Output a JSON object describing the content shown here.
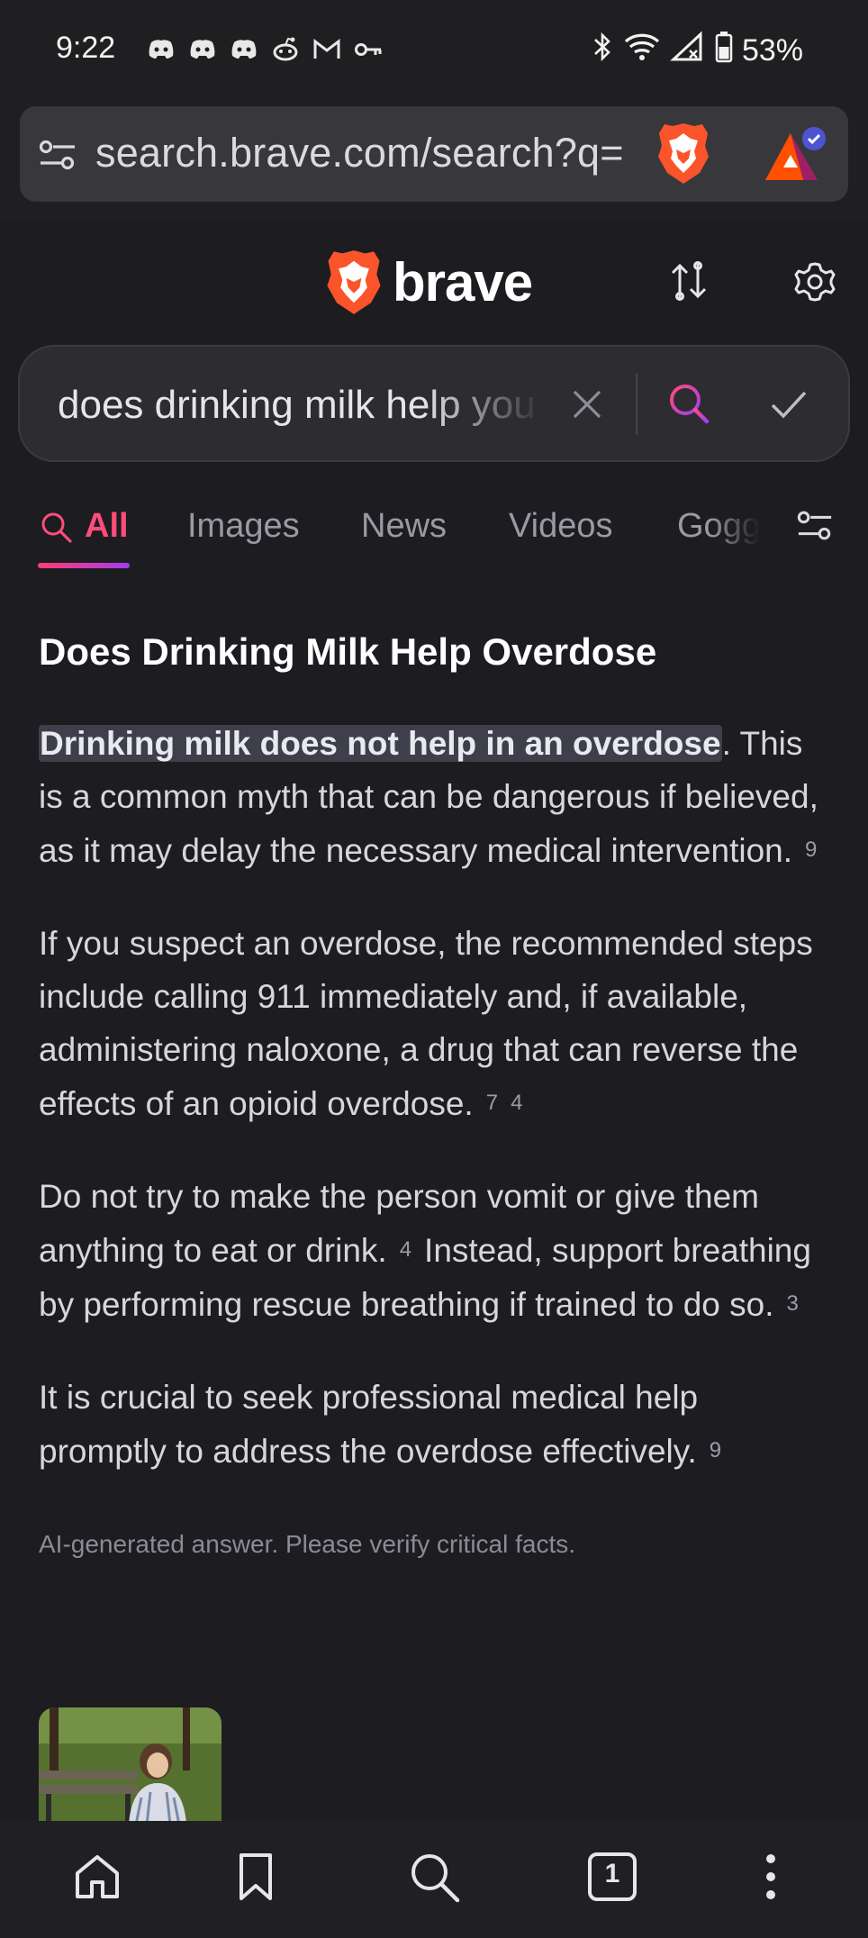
{
  "status_bar": {
    "time": "9:22",
    "battery": "53%"
  },
  "url_bar": {
    "url": "search.brave.com/search?q="
  },
  "header": {
    "brand": "brave"
  },
  "search": {
    "query": "does drinking milk help you overdose"
  },
  "tabs": [
    {
      "label": "All",
      "active": true
    },
    {
      "label": "Images"
    },
    {
      "label": "News"
    },
    {
      "label": "Videos"
    },
    {
      "label": "Goggles"
    }
  ],
  "answer": {
    "title": "Does Drinking Milk Help Overdose",
    "p1_highlight": "Drinking milk does not help in an overdose",
    "p1_line1_rest": ". This",
    "p1_rest": "is a common myth that can be dangerous if believed, as it may delay the necessary medical intervention.",
    "p1_cite": "9",
    "p2": "If you suspect an overdose, the recommended steps include calling 911 immediately and, if available, administering naloxone, a drug that can reverse the effects of an opioid overdose.",
    "p2_cite_a": "7",
    "p2_cite_b": "4",
    "p3a": "Do not try to make the person vomit or give them anything to eat or drink.",
    "p3_cite_a": "4",
    "p3b": "Instead, support breathing by performing rescue breathing if trained to do so.",
    "p3_cite_b": "3",
    "p4": "It is crucial to seek professional medical help promptly to address the overdose effectively.",
    "p4_cite": "9",
    "disclaimer": "AI-generated answer. Please verify critical facts."
  },
  "bottom_nav": {
    "tab_count": "1"
  },
  "colors": {
    "accent": "#ff4d7a",
    "brave_orange": "#fb542b",
    "background": "#1c1c21"
  }
}
